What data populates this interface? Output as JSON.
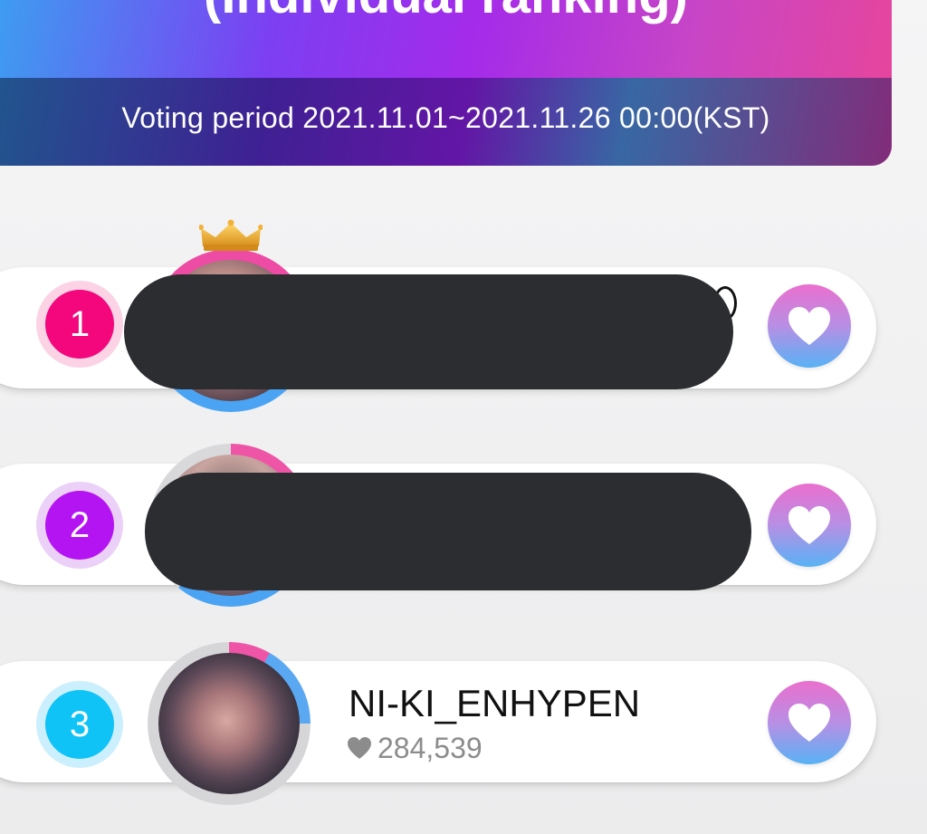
{
  "banner": {
    "title": "(Individual ranking)",
    "period": "Voting period 2021.11.01~2021.11.26 00:00(KST)"
  },
  "ranking": [
    {
      "rank": "1",
      "name": "",
      "votes": "",
      "redacted": true,
      "crown": true
    },
    {
      "rank": "2",
      "name": "",
      "votes": "",
      "redacted": true
    },
    {
      "rank": "3",
      "name": "NI-KI_ENHYPEN",
      "votes": "284,539",
      "redacted": false
    }
  ],
  "icons": {
    "vote_button": "heart-icon",
    "votes_count": "heart-icon",
    "first_place": "crown-icon"
  },
  "colors": {
    "rank1": "#f4067d",
    "rank2": "#b514f2",
    "rank3": "#0fc3f7",
    "heart_gradient_top": "#ea6fce",
    "heart_gradient_bottom": "#58b2f5"
  }
}
